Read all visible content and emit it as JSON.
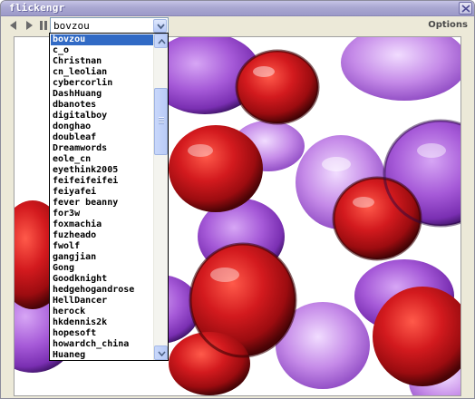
{
  "window": {
    "title": "flickengr"
  },
  "toolbar": {
    "prev_icon": "left-triangle-icon",
    "next_icon": "right-triangle-icon",
    "pause_icon": "pause-icon",
    "user_select": {
      "value": "bovzou"
    },
    "options_label": "Options"
  },
  "dropdown": {
    "selected_index": 0,
    "items": [
      "bovzou",
      "c_o",
      "Christnan",
      "cn_leolian",
      "cybercorlin",
      "DashHuang",
      "dbanotes",
      "digitalboy",
      "donghao",
      "doubleaf",
      "Dreamwords",
      "eole_cn",
      "eyethink2005",
      "feifeifeifei",
      "feiyafei",
      "fever beanny",
      "for3w",
      "foxmachia",
      "fuzheado",
      "fwolf",
      "gangjian",
      "Gong",
      "Goodknight",
      "hedgehogandrose",
      "HellDancer",
      "herock",
      "hkdennis2k",
      "hopesoft",
      "howardch_china",
      "Huaneg"
    ]
  },
  "photo": {
    "description_icon": "glass-marbles-photo",
    "colors": {
      "red": "#c0141a",
      "purple": "#9a4fcf",
      "background": "#ffffff"
    }
  }
}
